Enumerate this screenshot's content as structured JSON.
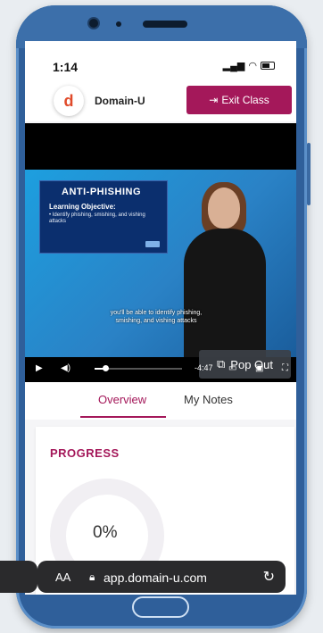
{
  "status": {
    "time": "1:14"
  },
  "app": {
    "logo_glyph": "d",
    "brand": "Domain-U",
    "exit_label": "Exit Class",
    "accent": "#a4185a"
  },
  "video": {
    "slide": {
      "title": "ANTI-PHISHING",
      "subtitle": "Learning Objective:",
      "bullet": "• Identify phishing, smishing, and vishing attacks"
    },
    "caption": "you'll be able to identify phishing, smishing, and vishing attacks",
    "popout_label": "Pop Out",
    "time_remaining": "-4:47",
    "progress": 0.12
  },
  "tabs": [
    {
      "label": "Overview",
      "active": true
    },
    {
      "label": "My Notes",
      "active": false
    }
  ],
  "progress_card": {
    "title": "PROGRESS",
    "value": "0%"
  },
  "browser": {
    "aa_label": "AA",
    "url": "app.domain-u.com"
  },
  "icons": {
    "exit": "sign-out-icon",
    "popout": "external-link-icon",
    "lock": "lock-icon",
    "reload": "reload-icon"
  }
}
